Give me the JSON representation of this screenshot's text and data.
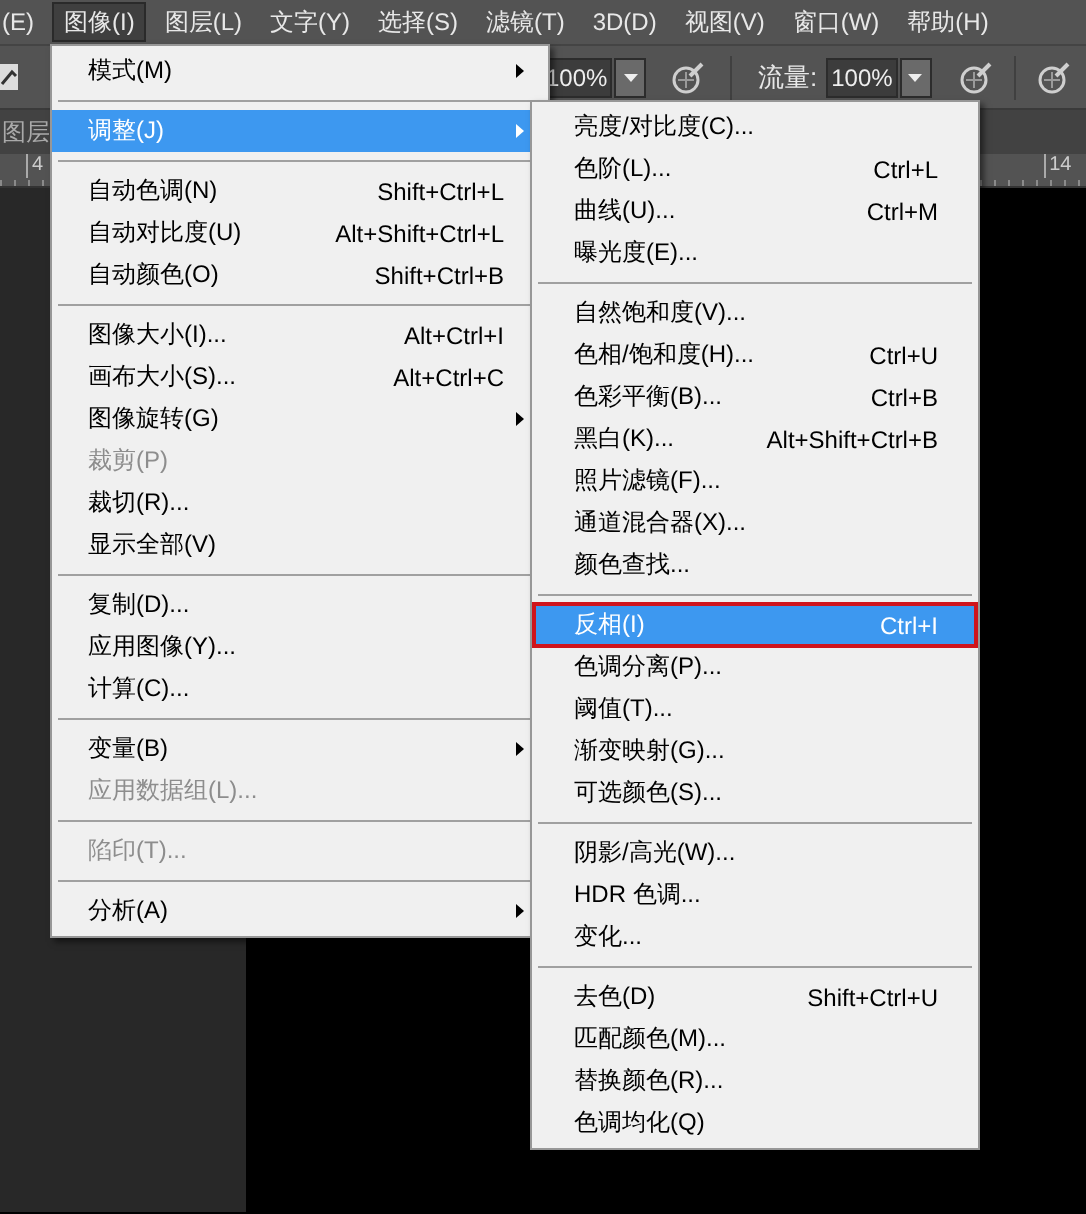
{
  "menu_bar": [
    {
      "label": "(E)",
      "selected": false
    },
    {
      "label": "图像(I)",
      "selected": true
    },
    {
      "label": "图层(L)",
      "selected": false
    },
    {
      "label": "文字(Y)",
      "selected": false
    },
    {
      "label": "选择(S)",
      "selected": false
    },
    {
      "label": "滤镜(T)",
      "selected": false
    },
    {
      "label": "3D(D)",
      "selected": false
    },
    {
      "label": "视图(V)",
      "selected": false
    },
    {
      "label": "窗口(W)",
      "selected": false
    },
    {
      "label": "帮助(H)",
      "selected": false
    }
  ],
  "options_bar": {
    "opacity": "100%",
    "flow_label": "流量:",
    "flow": "100%"
  },
  "document_tab": "图层",
  "ruler": [
    "4",
    "14"
  ],
  "image_menu": {
    "items": [
      {
        "kind": "item",
        "label": "模式(M)",
        "submenu": true,
        "selected": false,
        "disabled": false
      },
      {
        "kind": "separator"
      },
      {
        "kind": "item",
        "label": "调整(J)",
        "submenu": true,
        "selected": true,
        "disabled": false
      },
      {
        "kind": "separator"
      },
      {
        "kind": "item",
        "label": "自动色调(N)",
        "shortcut": "Shift+Ctrl+L",
        "selected": false,
        "disabled": false
      },
      {
        "kind": "item",
        "label": "自动对比度(U)",
        "shortcut": "Alt+Shift+Ctrl+L",
        "selected": false,
        "disabled": false
      },
      {
        "kind": "item",
        "label": "自动颜色(O)",
        "shortcut": "Shift+Ctrl+B",
        "selected": false,
        "disabled": false
      },
      {
        "kind": "separator"
      },
      {
        "kind": "item",
        "label": "图像大小(I)...",
        "shortcut": "Alt+Ctrl+I",
        "selected": false,
        "disabled": false
      },
      {
        "kind": "item",
        "label": "画布大小(S)...",
        "shortcut": "Alt+Ctrl+C",
        "selected": false,
        "disabled": false
      },
      {
        "kind": "item",
        "label": "图像旋转(G)",
        "submenu": true,
        "selected": false,
        "disabled": false
      },
      {
        "kind": "item",
        "label": "裁剪(P)",
        "selected": false,
        "disabled": true
      },
      {
        "kind": "item",
        "label": "裁切(R)...",
        "selected": false,
        "disabled": false
      },
      {
        "kind": "item",
        "label": "显示全部(V)",
        "selected": false,
        "disabled": false
      },
      {
        "kind": "separator"
      },
      {
        "kind": "item",
        "label": "复制(D)...",
        "selected": false,
        "disabled": false
      },
      {
        "kind": "item",
        "label": "应用图像(Y)...",
        "selected": false,
        "disabled": false
      },
      {
        "kind": "item",
        "label": "计算(C)...",
        "selected": false,
        "disabled": false
      },
      {
        "kind": "separator"
      },
      {
        "kind": "item",
        "label": "变量(B)",
        "submenu": true,
        "selected": false,
        "disabled": false
      },
      {
        "kind": "item",
        "label": "应用数据组(L)...",
        "selected": false,
        "disabled": true
      },
      {
        "kind": "separator"
      },
      {
        "kind": "item",
        "label": "陷印(T)...",
        "selected": false,
        "disabled": true
      },
      {
        "kind": "separator"
      },
      {
        "kind": "item",
        "label": "分析(A)",
        "submenu": true,
        "selected": false,
        "disabled": false
      }
    ]
  },
  "adjust_submenu": {
    "items": [
      {
        "kind": "item",
        "label": "亮度/对比度(C)...",
        "selected": false
      },
      {
        "kind": "item",
        "label": "色阶(L)...",
        "shortcut": "Ctrl+L",
        "selected": false
      },
      {
        "kind": "item",
        "label": "曲线(U)...",
        "shortcut": "Ctrl+M",
        "selected": false
      },
      {
        "kind": "item",
        "label": "曝光度(E)...",
        "selected": false
      },
      {
        "kind": "separator"
      },
      {
        "kind": "item",
        "label": "自然饱和度(V)...",
        "selected": false
      },
      {
        "kind": "item",
        "label": "色相/饱和度(H)...",
        "shortcut": "Ctrl+U",
        "selected": false
      },
      {
        "kind": "item",
        "label": "色彩平衡(B)...",
        "shortcut": "Ctrl+B",
        "selected": false
      },
      {
        "kind": "item",
        "label": "黑白(K)...",
        "shortcut": "Alt+Shift+Ctrl+B",
        "selected": false
      },
      {
        "kind": "item",
        "label": "照片滤镜(F)...",
        "selected": false
      },
      {
        "kind": "item",
        "label": "通道混合器(X)...",
        "selected": false
      },
      {
        "kind": "item",
        "label": "颜色查找...",
        "selected": false
      },
      {
        "kind": "separator"
      },
      {
        "kind": "item",
        "label": "反相(I)",
        "shortcut": "Ctrl+I",
        "selected": true,
        "outlined": true
      },
      {
        "kind": "item",
        "label": "色调分离(P)...",
        "selected": false
      },
      {
        "kind": "item",
        "label": "阈值(T)...",
        "selected": false
      },
      {
        "kind": "item",
        "label": "渐变映射(G)...",
        "selected": false
      },
      {
        "kind": "item",
        "label": "可选颜色(S)...",
        "selected": false
      },
      {
        "kind": "separator"
      },
      {
        "kind": "item",
        "label": "阴影/高光(W)...",
        "selected": false
      },
      {
        "kind": "item",
        "label": "HDR 色调...",
        "selected": false
      },
      {
        "kind": "item",
        "label": "变化...",
        "selected": false
      },
      {
        "kind": "separator"
      },
      {
        "kind": "item",
        "label": "去色(D)",
        "shortcut": "Shift+Ctrl+U",
        "selected": false
      },
      {
        "kind": "item",
        "label": "匹配颜色(M)...",
        "selected": false
      },
      {
        "kind": "item",
        "label": "替换颜色(R)...",
        "selected": false
      },
      {
        "kind": "item",
        "label": "色调均化(Q)",
        "selected": false
      }
    ]
  }
}
